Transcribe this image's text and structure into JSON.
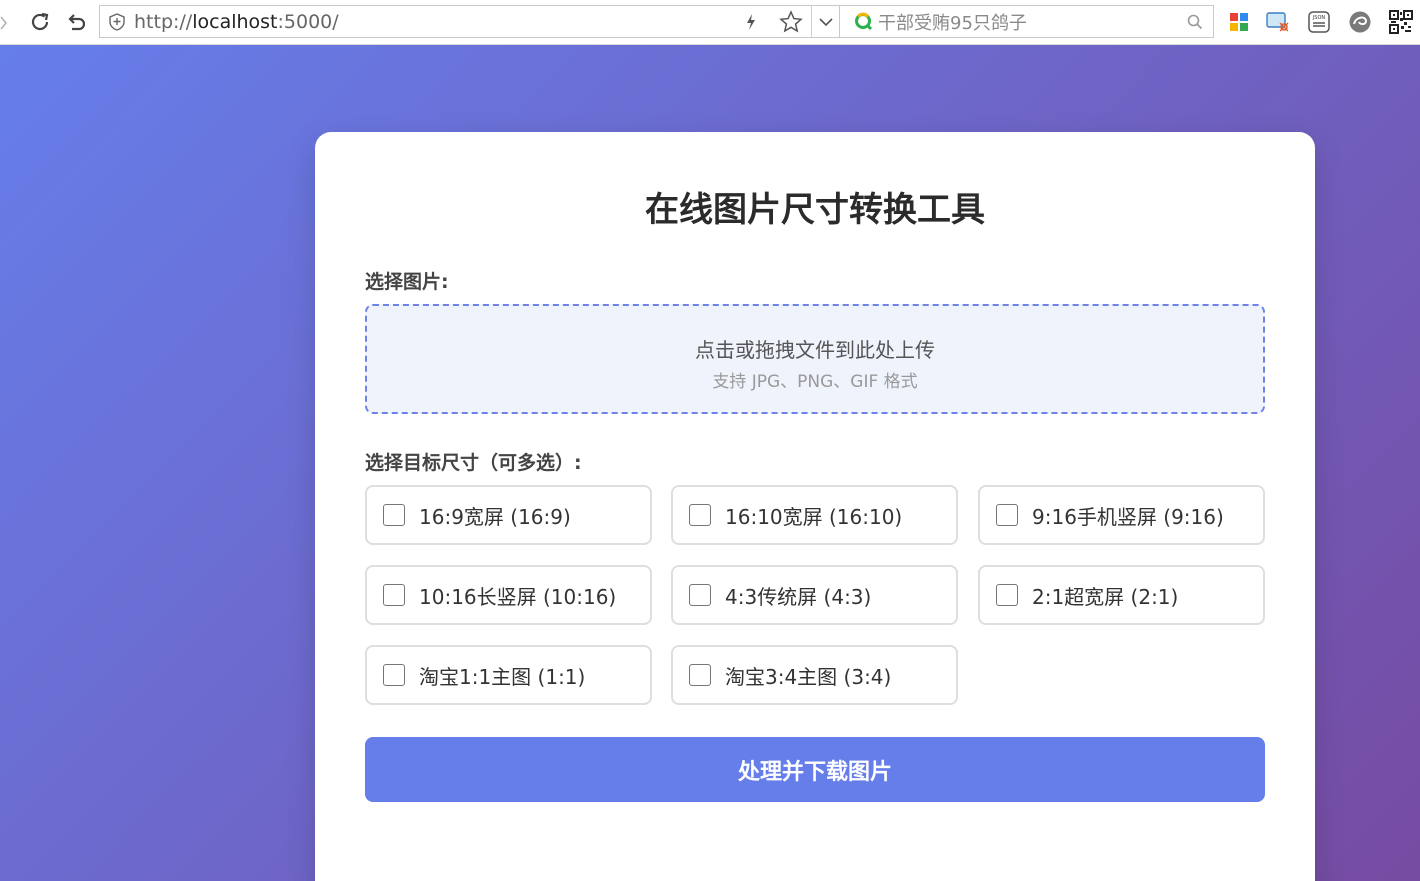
{
  "browser": {
    "url_scheme": "http://",
    "url_host": "localhost",
    "url_rest": ":5000/",
    "search_text": "干部受贿95只鸽子"
  },
  "page": {
    "title": "在线图片尺寸转换工具",
    "select_image_label": "选择图片:",
    "dropzone": {
      "main_text": "点击或拖拽文件到此处上传",
      "sub_text": "支持 JPG、PNG、GIF 格式"
    },
    "size_label": "选择目标尺寸（可多选）:",
    "options": [
      {
        "label": "16:9宽屏 (16:9)",
        "checked": false
      },
      {
        "label": "16:10宽屏 (16:10)",
        "checked": false
      },
      {
        "label": "9:16手机竖屏 (9:16)",
        "checked": false
      },
      {
        "label": "10:16长竖屏 (10:16)",
        "checked": false
      },
      {
        "label": "4:3传统屏 (4:3)",
        "checked": false
      },
      {
        "label": "2:1超宽屏 (2:1)",
        "checked": false
      },
      {
        "label": "淘宝1:1主图 (1:1)",
        "checked": false
      },
      {
        "label": "淘宝3:4主图 (3:4)",
        "checked": false
      }
    ],
    "submit_label": "处理并下载图片"
  },
  "colors": {
    "gradient_start": "#667eea",
    "gradient_end": "#764ba2",
    "button": "#667eea",
    "dropzone_border": "#6f82e6"
  }
}
